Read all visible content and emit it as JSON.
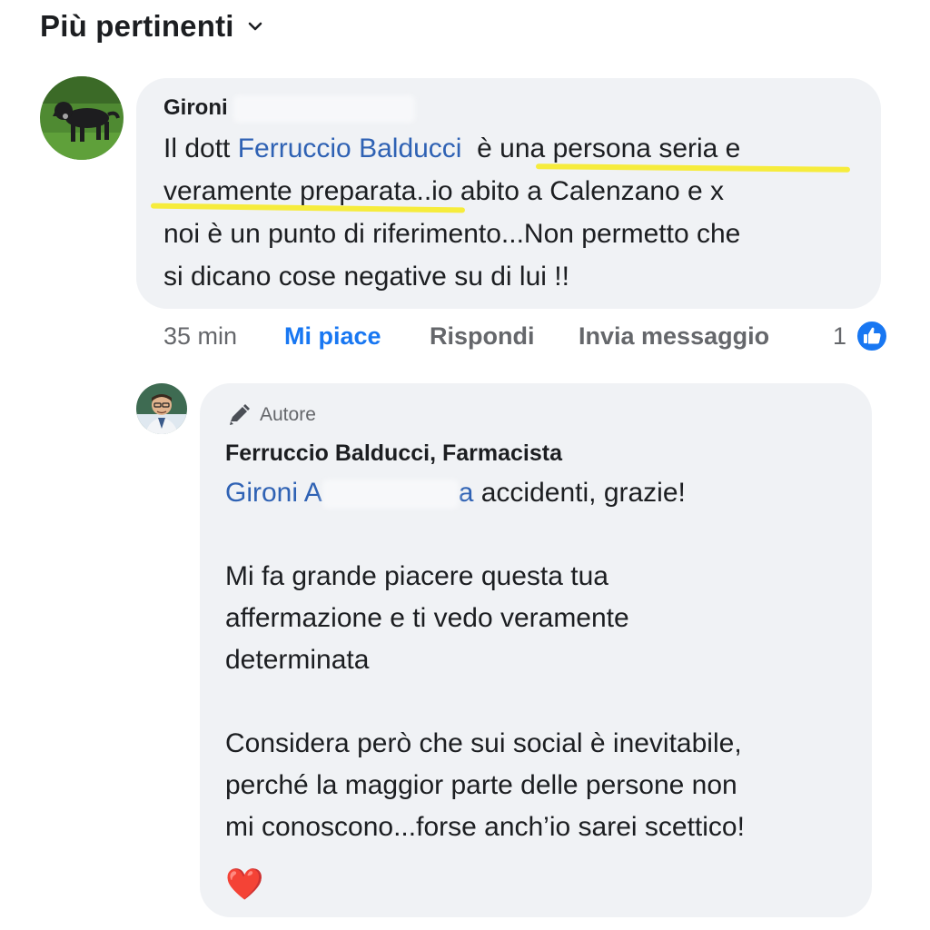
{
  "sort": {
    "label": "Più pertinenti",
    "icon": "chevron-down-icon"
  },
  "comment": {
    "author": "Gironi",
    "text_parts": {
      "intro": "Il dott ",
      "mention": "Ferruccio Balducci",
      "line1_rest": "è una persona seria e",
      "line2_hl": "veramente preparata",
      "line2_rest": "..io abito a Calenzano e x",
      "line3": "noi è un punto di riferimento...Non permetto che",
      "line4": "si dicano cose negative su di lui !!"
    },
    "highlight_color": "#f6ec3c",
    "actions": {
      "time": "35 min",
      "like": "Mi piace",
      "reply": "Rispondi",
      "message": "Invia messaggio",
      "reaction_count": "1",
      "reaction_icon": "thumbs-up-icon"
    }
  },
  "reply": {
    "badge_icon": "pencil-icon",
    "badge_label": "Autore",
    "author": "Ferruccio Balducci, Farmacista",
    "mention_visible": "Gironi A",
    "mention_tail": "a",
    "line1_rest": "accidenti, grazie!",
    "para1": [
      "Mi fa grande piacere questa tua",
      "affermazione e ti vedo veramente",
      "determinata"
    ],
    "para2": [
      "Considera però che sui social è inevitabile,",
      "perché la maggior parte delle persone non",
      "mi conoscono...forse anch’io sarei scettico!"
    ],
    "emoji": "❤️"
  },
  "colors": {
    "accent": "#1877f2",
    "mention": "#2f62b4",
    "bubble": "#f0f2f5",
    "muted": "#65676b"
  }
}
